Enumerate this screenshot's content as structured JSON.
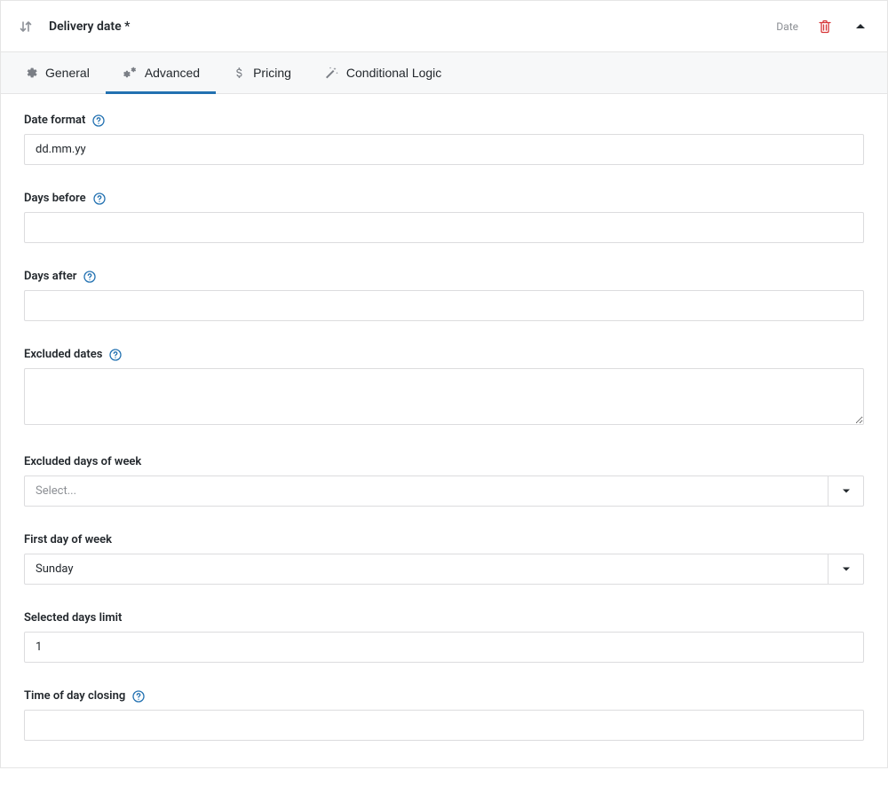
{
  "header": {
    "title": "Delivery date *",
    "type_label": "Date"
  },
  "tabs": {
    "general": "General",
    "advanced": "Advanced",
    "pricing": "Pricing",
    "conditional": "Conditional Logic"
  },
  "fields": {
    "date_format": {
      "label": "Date format",
      "value": "dd.mm.yy"
    },
    "days_before": {
      "label": "Days before",
      "value": ""
    },
    "days_after": {
      "label": "Days after",
      "value": ""
    },
    "excluded_dates": {
      "label": "Excluded dates",
      "value": ""
    },
    "excluded_days_of_week": {
      "label": "Excluded days of week",
      "placeholder": "Select..."
    },
    "first_day_of_week": {
      "label": "First day of week",
      "value": "Sunday"
    },
    "selected_days_limit": {
      "label": "Selected days limit",
      "value": "1"
    },
    "time_of_day_closing": {
      "label": "Time of day closing",
      "value": ""
    }
  }
}
